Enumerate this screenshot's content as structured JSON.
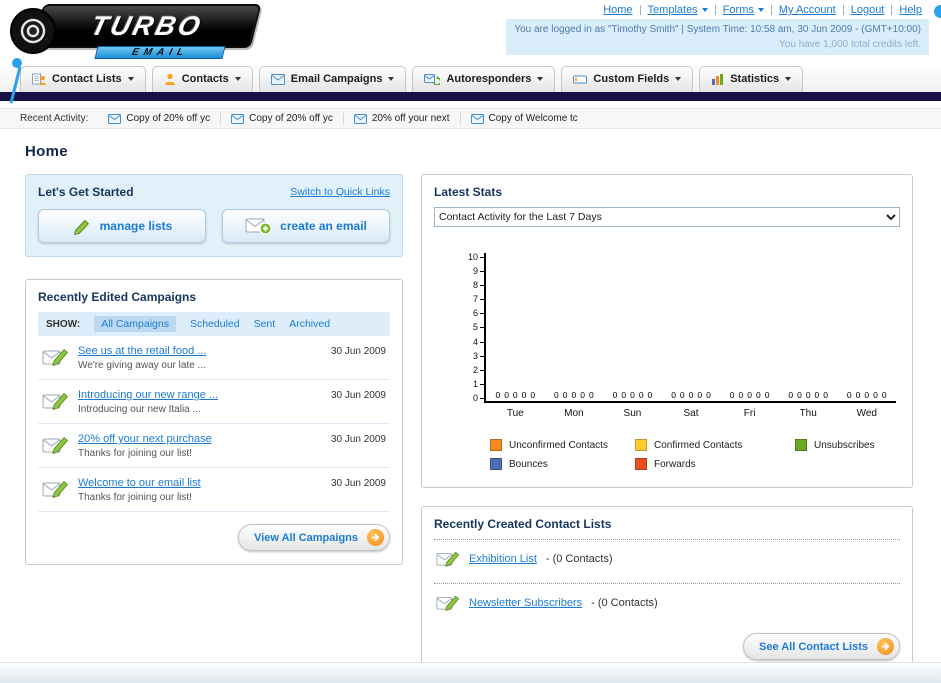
{
  "brand": {
    "navy_bar": "#171245",
    "link_blue": "#1c7cd0",
    "logo_title": "TURBO",
    "logo_subtitle": "EMAIL"
  },
  "header": {
    "nav_links": [
      {
        "label": "Home",
        "has_menu": false
      },
      {
        "label": "Templates",
        "has_menu": true
      },
      {
        "label": "Forms",
        "has_menu": true
      },
      {
        "label": "My Account",
        "has_menu": false
      },
      {
        "label": "Logout",
        "has_menu": false
      },
      {
        "label": "Help",
        "has_menu": false
      }
    ],
    "login_line": "You are logged in as \"Timothy Smith\" | System Time: 10:58 am, 30 Jun 2009 - (GMT+10:00)",
    "credits_line": "You have 1,000 total credits left."
  },
  "main_nav": {
    "tabs": [
      {
        "label": "Contact Lists"
      },
      {
        "label": "Contacts"
      },
      {
        "label": "Email Campaigns"
      },
      {
        "label": "Autoresponders"
      },
      {
        "label": "Custom Fields"
      },
      {
        "label": "Statistics"
      }
    ]
  },
  "recent_activity": {
    "label": "Recent Activity:",
    "items": [
      "Copy of 20% off yc",
      "Copy of 20% off yc",
      "20% off your next",
      "Copy of Welcome tc"
    ]
  },
  "page": {
    "title": "Home"
  },
  "get_started": {
    "title": "Let's Get Started",
    "switch_link": "Switch to Quick Links",
    "manage_lists_label": "manage lists",
    "create_email_label": "create an email"
  },
  "campaigns": {
    "title": "Recently Edited Campaigns",
    "show_label": "SHOW:",
    "filters": [
      "All Campaigns",
      "Scheduled",
      "Sent",
      "Archived"
    ],
    "active_filter": "All Campaigns",
    "items": [
      {
        "title": "See us at the retail food ...",
        "subtitle": "We're giving away our late ...",
        "date": "30 Jun 2009"
      },
      {
        "title": "Introducing our new range ...",
        "subtitle": "Introducing our new Italia ...",
        "date": "30 Jun 2009"
      },
      {
        "title": "20% off your next purchase",
        "subtitle": "Thanks for joining our list!",
        "date": "30 Jun 2009"
      },
      {
        "title": "Welcome to our email list",
        "subtitle": "Thanks for joining our list!",
        "date": "30 Jun 2009"
      }
    ],
    "view_all_label": "View All Campaigns"
  },
  "stats": {
    "title": "Latest Stats",
    "period_selector": "Contact Activity for the Last 7 Days",
    "chart_data": {
      "type": "bar",
      "title": "Contact Activity for the Last 7 Days",
      "categories": [
        "Tue",
        "Mon",
        "Sun",
        "Sat",
        "Fri",
        "Thu",
        "Wed"
      ],
      "series": [
        {
          "name": "Unconfirmed Contacts",
          "color": "#f68b1f",
          "values": [
            0,
            0,
            0,
            0,
            0,
            0,
            0
          ]
        },
        {
          "name": "Confirmed Contacts",
          "color": "#ffcc33",
          "values": [
            0,
            0,
            0,
            0,
            0,
            0,
            0
          ]
        },
        {
          "name": "Unsubscribes",
          "color": "#6aaa23",
          "values": [
            0,
            0,
            0,
            0,
            0,
            0,
            0
          ]
        },
        {
          "name": "Bounces",
          "color": "#4a6fb5",
          "values": [
            0,
            0,
            0,
            0,
            0,
            0,
            0
          ]
        },
        {
          "name": "Forwards",
          "color": "#e8501f",
          "values": [
            0,
            0,
            0,
            0,
            0,
            0,
            0
          ]
        }
      ],
      "ylim": [
        0,
        10
      ],
      "y_tick_step": 1,
      "grid": false,
      "legend_position": "bottom"
    }
  },
  "contact_lists": {
    "title": "Recently Created Contact Lists",
    "items": [
      {
        "name": "Exhibition List",
        "detail": "- (0 Contacts)"
      },
      {
        "name": "Newsletter Subscribers",
        "detail": "- (0 Contacts)"
      }
    ],
    "see_all_label": "See All Contact Lists"
  }
}
